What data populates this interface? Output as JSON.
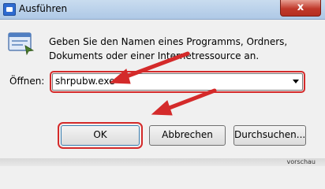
{
  "window": {
    "title": "Ausführen",
    "close_glyph": "x",
    "run_icon": "run-icon"
  },
  "dialog": {
    "prompt": "Geben Sie den Namen eines Programms, Ordners, Dokuments oder einer Internetressource an.",
    "open_label": "Öffnen:",
    "open_value": "shrpubw.exe"
  },
  "buttons": {
    "ok": "OK",
    "cancel": "Abbrechen",
    "browse": "Durchsuchen..."
  },
  "footer": {
    "partial_text": "vorschau"
  },
  "colors": {
    "annotation_red": "#d42a2a",
    "title_blue": "#aec8e6"
  }
}
